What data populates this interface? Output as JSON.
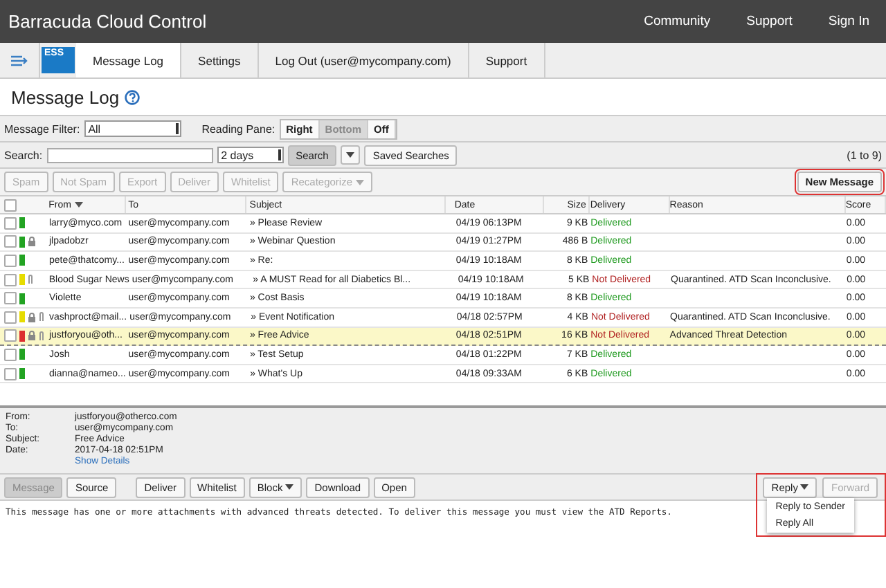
{
  "header": {
    "brand_light": "Barracuda",
    "brand_bold": "Cloud Control",
    "links": [
      "Community",
      "Support",
      "Sign In"
    ]
  },
  "nav": {
    "badge": "ESS",
    "tabs": [
      {
        "label": "Message Log",
        "selected": true
      },
      {
        "label": "Settings",
        "selected": false
      },
      {
        "label": "Log Out (user@mycompany.com)",
        "selected": false
      },
      {
        "label": "Support",
        "selected": false
      }
    ]
  },
  "page_title": "Message Log",
  "filter": {
    "label": "Message Filter:",
    "value": "All",
    "reading_label": "Reading Pane:",
    "reading_options": [
      {
        "label": "Right",
        "selected": false
      },
      {
        "label": "Bottom",
        "selected": true
      },
      {
        "label": "Off",
        "selected": false
      }
    ]
  },
  "search": {
    "label": "Search:",
    "range": "2 days",
    "button": "Search",
    "saved": "Saved Searches",
    "count": "(1 to 9)"
  },
  "actions": [
    {
      "label": "Spam",
      "disabled": true,
      "menu": false
    },
    {
      "label": "Not Spam",
      "disabled": true,
      "menu": false
    },
    {
      "label": "Export",
      "disabled": true,
      "menu": false
    },
    {
      "label": "Deliver",
      "disabled": true,
      "menu": false
    },
    {
      "label": "Whitelist",
      "disabled": true,
      "menu": false
    },
    {
      "label": "Recategorize",
      "disabled": true,
      "menu": true
    }
  ],
  "new_message": "New Message",
  "select_all": {
    "checked": false
  },
  "columns": [
    "From",
    "To",
    "Subject",
    "Date",
    "Size",
    "Delivery",
    "Reason",
    "Score"
  ],
  "rows": [
    {
      "color": "#22a322",
      "lock": false,
      "attach": false,
      "from": "larry@myco.com",
      "to": "user@mycompany.com",
      "subject": "» Please Review",
      "date": "04/19 06:13PM",
      "size": "9 KB",
      "delivered": true,
      "delivery": "Delivered",
      "reason": "",
      "score": "0.00",
      "selected": false
    },
    {
      "color": "#22a322",
      "lock": true,
      "attach": false,
      "from": "jlpadobzr",
      "to": "user@mycompany.com",
      "subject": "» Webinar Question",
      "date": "04/19 01:27PM",
      "size": "486 B",
      "delivered": true,
      "delivery": "Delivered",
      "reason": "",
      "score": "0.00",
      "selected": false
    },
    {
      "color": "#22a322",
      "lock": false,
      "attach": false,
      "from": "pete@thatcomy...",
      "to": "user@mycompany.com",
      "subject": "» Re:",
      "date": "04/19 10:18AM",
      "size": "8 KB",
      "delivered": true,
      "delivery": "Delivered",
      "reason": "",
      "score": "0.00",
      "selected": false
    },
    {
      "color": "#e6dc00",
      "lock": false,
      "attach": true,
      "from": "Blood Sugar News",
      "to": "user@mycompany.com",
      "subject": "» A MUST Read for all Diabetics Bl...",
      "date": "04/19 10:18AM",
      "size": "5 KB",
      "delivered": false,
      "delivery": "Not Delivered",
      "reason": "Quarantined. ATD Scan Inconclusive.",
      "score": "0.00",
      "selected": false
    },
    {
      "color": "#22a322",
      "lock": false,
      "attach": false,
      "from": "Violette",
      "to": "user@mycompany.com",
      "subject": "» Cost Basis",
      "date": "04/19 10:18AM",
      "size": "8 KB",
      "delivered": true,
      "delivery": "Delivered",
      "reason": "",
      "score": "0.00",
      "selected": false
    },
    {
      "color": "#e6dc00",
      "lock": true,
      "attach": true,
      "from": "vashproct@mail...",
      "to": "user@mycompany.com",
      "subject": "» Event Notification",
      "date": "04/18 02:57PM",
      "size": "4 KB",
      "delivered": false,
      "delivery": "Not Delivered",
      "reason": "Quarantined. ATD Scan Inconclusive.",
      "score": "0.00",
      "selected": false
    },
    {
      "color": "#dd3030",
      "lock": true,
      "attach": true,
      "from": "justforyou@oth...",
      "to": "user@mycompany.com",
      "subject": "» Free Advice",
      "date": "04/18 02:51PM",
      "size": "16 KB",
      "delivered": false,
      "delivery": "Not Delivered",
      "reason": "Advanced Threat Detection",
      "score": "0.00",
      "selected": true
    },
    {
      "color": "#22a322",
      "lock": false,
      "attach": false,
      "from": "Josh",
      "to": "user@mycompany.com",
      "subject": "» Test Setup",
      "date": "04/18 01:22PM",
      "size": "7 KB",
      "delivered": true,
      "delivery": "Delivered",
      "reason": "",
      "score": "0.00",
      "selected": false
    },
    {
      "color": "#22a322",
      "lock": false,
      "attach": false,
      "from": "dianna@nameo...",
      "to": "user@mycompany.com",
      "subject": "» What's Up",
      "date": "04/18 09:33AM",
      "size": "6 KB",
      "delivered": true,
      "delivery": "Delivered",
      "reason": "",
      "score": "0.00",
      "selected": false
    }
  ],
  "preview": {
    "fields": [
      {
        "label": "From:",
        "value": "justforyou@otherco.com"
      },
      {
        "label": "To:",
        "value": "user@mycompany.com"
      },
      {
        "label": "Subject:",
        "value": "Free Advice"
      },
      {
        "label": "Date:",
        "value": "2017-04-18 02:51PM"
      }
    ],
    "details_link": "Show Details",
    "view_tabs": [
      {
        "label": "Message",
        "selected": true
      },
      {
        "label": "Source",
        "selected": false
      }
    ],
    "actions": [
      {
        "label": "Deliver",
        "menu": false
      },
      {
        "label": "Whitelist",
        "menu": false
      },
      {
        "label": "Block",
        "menu": true
      },
      {
        "label": "Download",
        "menu": false
      },
      {
        "label": "Open",
        "menu": false
      }
    ],
    "reply": "Reply",
    "forward": "Forward",
    "reply_menu": [
      "Reply to Sender",
      "Reply All"
    ],
    "body": "This message has one or more attachments with advanced threats detected. To deliver this message you must view the ATD Reports."
  }
}
